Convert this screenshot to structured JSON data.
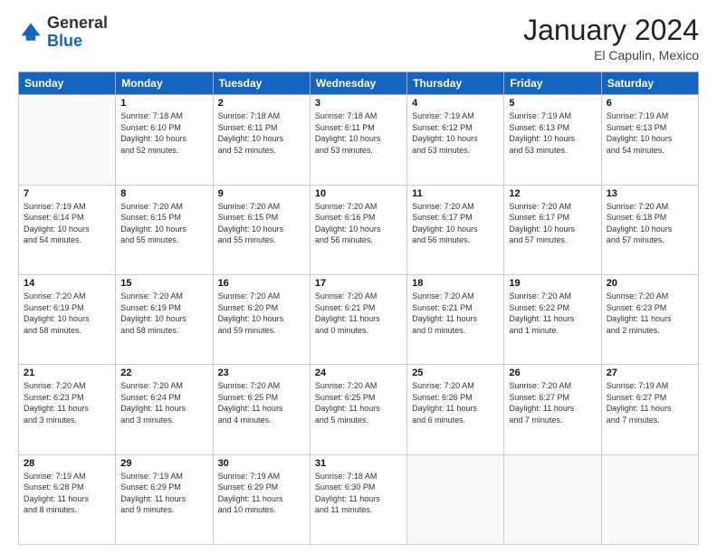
{
  "logo": {
    "general": "General",
    "blue": "Blue"
  },
  "header": {
    "month": "January 2024",
    "location": "El Capulin, Mexico"
  },
  "days_of_week": [
    "Sunday",
    "Monday",
    "Tuesday",
    "Wednesday",
    "Thursday",
    "Friday",
    "Saturday"
  ],
  "weeks": [
    [
      {
        "num": "",
        "info": ""
      },
      {
        "num": "1",
        "info": "Sunrise: 7:18 AM\nSunset: 6:10 PM\nDaylight: 10 hours\nand 52 minutes."
      },
      {
        "num": "2",
        "info": "Sunrise: 7:18 AM\nSunset: 6:11 PM\nDaylight: 10 hours\nand 52 minutes."
      },
      {
        "num": "3",
        "info": "Sunrise: 7:18 AM\nSunset: 6:11 PM\nDaylight: 10 hours\nand 53 minutes."
      },
      {
        "num": "4",
        "info": "Sunrise: 7:19 AM\nSunset: 6:12 PM\nDaylight: 10 hours\nand 53 minutes."
      },
      {
        "num": "5",
        "info": "Sunrise: 7:19 AM\nSunset: 6:13 PM\nDaylight: 10 hours\nand 53 minutes."
      },
      {
        "num": "6",
        "info": "Sunrise: 7:19 AM\nSunset: 6:13 PM\nDaylight: 10 hours\nand 54 minutes."
      }
    ],
    [
      {
        "num": "7",
        "info": "Sunrise: 7:19 AM\nSunset: 6:14 PM\nDaylight: 10 hours\nand 54 minutes."
      },
      {
        "num": "8",
        "info": "Sunrise: 7:20 AM\nSunset: 6:15 PM\nDaylight: 10 hours\nand 55 minutes."
      },
      {
        "num": "9",
        "info": "Sunrise: 7:20 AM\nSunset: 6:15 PM\nDaylight: 10 hours\nand 55 minutes."
      },
      {
        "num": "10",
        "info": "Sunrise: 7:20 AM\nSunset: 6:16 PM\nDaylight: 10 hours\nand 56 minutes."
      },
      {
        "num": "11",
        "info": "Sunrise: 7:20 AM\nSunset: 6:17 PM\nDaylight: 10 hours\nand 56 minutes."
      },
      {
        "num": "12",
        "info": "Sunrise: 7:20 AM\nSunset: 6:17 PM\nDaylight: 10 hours\nand 57 minutes."
      },
      {
        "num": "13",
        "info": "Sunrise: 7:20 AM\nSunset: 6:18 PM\nDaylight: 10 hours\nand 57 minutes."
      }
    ],
    [
      {
        "num": "14",
        "info": "Sunrise: 7:20 AM\nSunset: 6:19 PM\nDaylight: 10 hours\nand 58 minutes."
      },
      {
        "num": "15",
        "info": "Sunrise: 7:20 AM\nSunset: 6:19 PM\nDaylight: 10 hours\nand 58 minutes."
      },
      {
        "num": "16",
        "info": "Sunrise: 7:20 AM\nSunset: 6:20 PM\nDaylight: 10 hours\nand 59 minutes."
      },
      {
        "num": "17",
        "info": "Sunrise: 7:20 AM\nSunset: 6:21 PM\nDaylight: 11 hours\nand 0 minutes."
      },
      {
        "num": "18",
        "info": "Sunrise: 7:20 AM\nSunset: 6:21 PM\nDaylight: 11 hours\nand 0 minutes."
      },
      {
        "num": "19",
        "info": "Sunrise: 7:20 AM\nSunset: 6:22 PM\nDaylight: 11 hours\nand 1 minute."
      },
      {
        "num": "20",
        "info": "Sunrise: 7:20 AM\nSunset: 6:23 PM\nDaylight: 11 hours\nand 2 minutes."
      }
    ],
    [
      {
        "num": "21",
        "info": "Sunrise: 7:20 AM\nSunset: 6:23 PM\nDaylight: 11 hours\nand 3 minutes."
      },
      {
        "num": "22",
        "info": "Sunrise: 7:20 AM\nSunset: 6:24 PM\nDaylight: 11 hours\nand 3 minutes."
      },
      {
        "num": "23",
        "info": "Sunrise: 7:20 AM\nSunset: 6:25 PM\nDaylight: 11 hours\nand 4 minutes."
      },
      {
        "num": "24",
        "info": "Sunrise: 7:20 AM\nSunset: 6:25 PM\nDaylight: 11 hours\nand 5 minutes."
      },
      {
        "num": "25",
        "info": "Sunrise: 7:20 AM\nSunset: 6:26 PM\nDaylight: 11 hours\nand 6 minutes."
      },
      {
        "num": "26",
        "info": "Sunrise: 7:20 AM\nSunset: 6:27 PM\nDaylight: 11 hours\nand 7 minutes."
      },
      {
        "num": "27",
        "info": "Sunrise: 7:19 AM\nSunset: 6:27 PM\nDaylight: 11 hours\nand 7 minutes."
      }
    ],
    [
      {
        "num": "28",
        "info": "Sunrise: 7:19 AM\nSunset: 6:28 PM\nDaylight: 11 hours\nand 8 minutes."
      },
      {
        "num": "29",
        "info": "Sunrise: 7:19 AM\nSunset: 6:29 PM\nDaylight: 11 hours\nand 9 minutes."
      },
      {
        "num": "30",
        "info": "Sunrise: 7:19 AM\nSunset: 6:29 PM\nDaylight: 11 hours\nand 10 minutes."
      },
      {
        "num": "31",
        "info": "Sunrise: 7:18 AM\nSunset: 6:30 PM\nDaylight: 11 hours\nand 11 minutes."
      },
      {
        "num": "",
        "info": ""
      },
      {
        "num": "",
        "info": ""
      },
      {
        "num": "",
        "info": ""
      }
    ]
  ]
}
